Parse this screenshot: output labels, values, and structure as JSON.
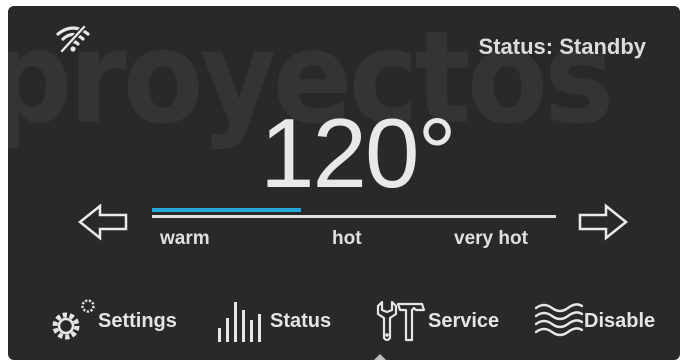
{
  "watermark": {
    "text": "proyectos"
  },
  "header": {
    "wifi_icon": "wifi-off-icon",
    "status_text": "Status: Standby"
  },
  "temperature": {
    "value_text": "120°",
    "level_fraction": 0.37
  },
  "controls": {
    "left_arrow_icon": "arrow-left-icon",
    "right_arrow_icon": "arrow-right-icon",
    "scale_labels": [
      "warm",
      "hot",
      "very hot"
    ]
  },
  "nav": {
    "items": [
      {
        "label": "Settings",
        "icon": "gear-icon"
      },
      {
        "label": "Status",
        "icon": "bar-chart-icon"
      },
      {
        "label": "Service",
        "icon": "tools-icon"
      },
      {
        "label": "Disable",
        "icon": "waves-icon"
      }
    ]
  },
  "colors": {
    "background": "#2a2828",
    "accent": "#27a9d8",
    "text": "#e6e6e6"
  }
}
